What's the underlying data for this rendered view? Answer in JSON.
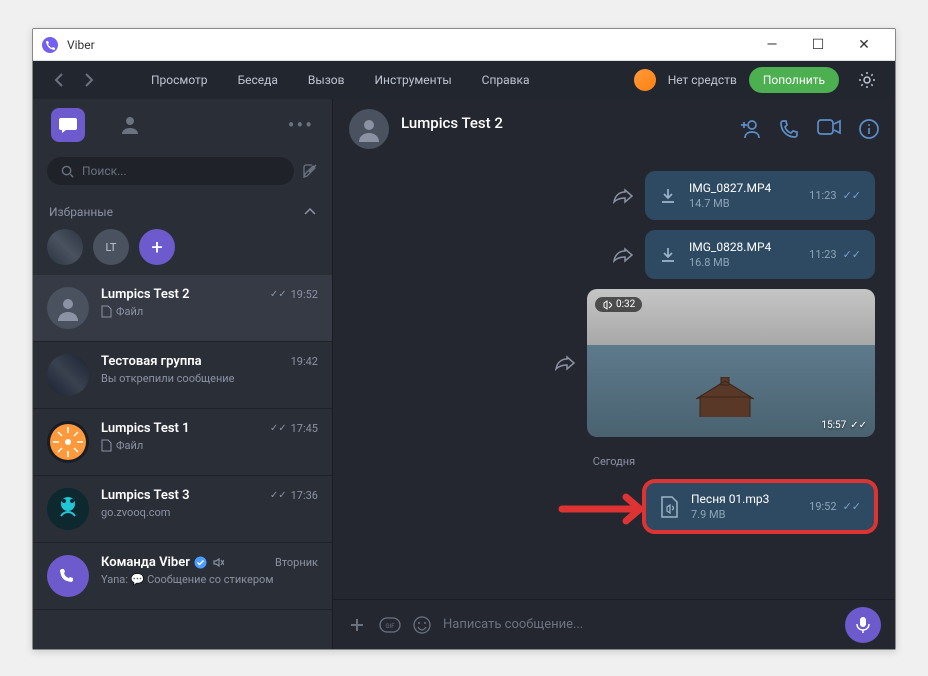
{
  "window": {
    "title": "Viber"
  },
  "menu": {
    "view": "Просмотр",
    "chat": "Беседа",
    "call": "Вызов",
    "tools": "Инструменты",
    "help": "Справка",
    "balance": "Нет средств",
    "topup": "Пополнить"
  },
  "search": {
    "placeholder": "Поиск..."
  },
  "favorites": {
    "label": "Избранные",
    "lt": "LT"
  },
  "chats": [
    {
      "name": "Lumpics Test 2",
      "preview": "Файл",
      "time": "19:52",
      "ticks": "✓✓",
      "selected": true,
      "avatar": "person"
    },
    {
      "name": "Тестовая группа",
      "preview": "Вы открепили сообщение",
      "time": "19:42",
      "avatar": "photo"
    },
    {
      "name": "Lumpics Test 1",
      "preview": "Файл",
      "time": "17:45",
      "ticks": "✓✓",
      "avatar": "orange"
    },
    {
      "name": "Lumpics Test 3",
      "preview": "go.zvooq.com",
      "time": "17:36",
      "ticks": "✓✓",
      "avatar": "cyan"
    },
    {
      "name": "Команда Viber",
      "preview": "Yana: 💬 Сообщение со стикером",
      "time": "Вторник",
      "verified": true,
      "muted": true,
      "avatar": "viber"
    }
  ],
  "header": {
    "name": "Lumpics Test 2"
  },
  "messages": {
    "file1": {
      "name": "IMG_0827.MP4",
      "size": "14.7 MB",
      "time": "11:23"
    },
    "file2": {
      "name": "IMG_0828.MP4",
      "size": "16.8 MB",
      "time": "11:23"
    },
    "video": {
      "dur": "0:32",
      "time": "15:57"
    },
    "divider": "Сегодня",
    "file3": {
      "name": "Песня 01.mp3",
      "size": "7.9 MB",
      "time": "19:52"
    }
  },
  "composer": {
    "placeholder": "Написать сообщение..."
  }
}
